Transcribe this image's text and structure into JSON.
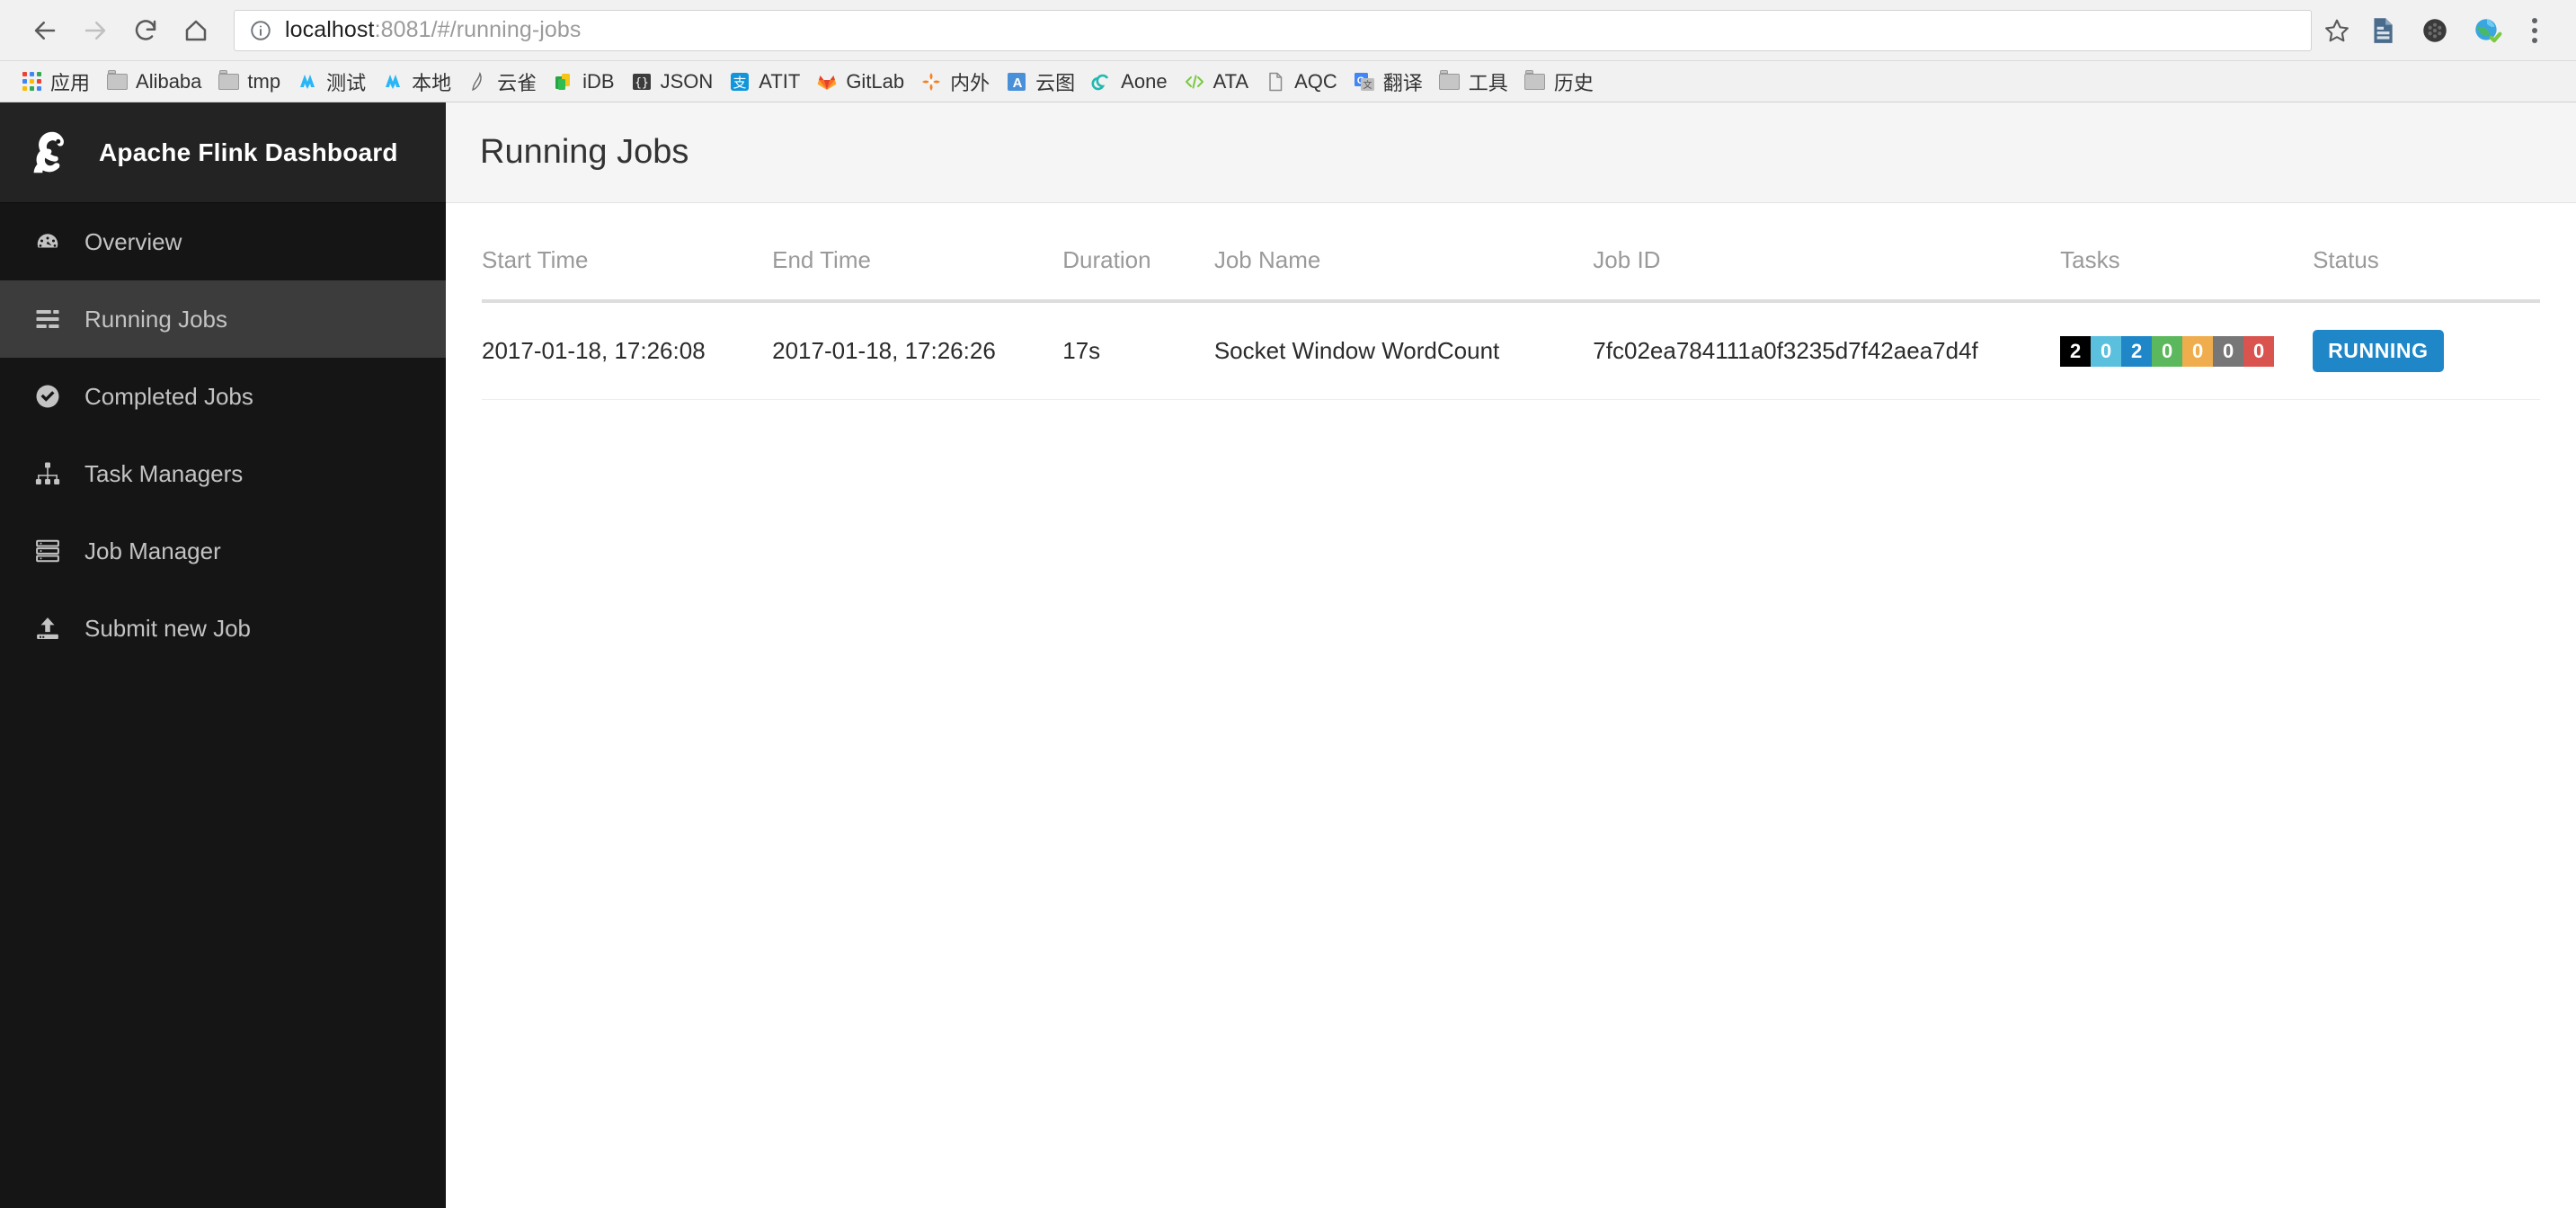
{
  "browser": {
    "back_label": "Back",
    "forward_label": "Forward",
    "reload_label": "Reload",
    "home_label": "Home",
    "url_host": "localhost",
    "url_rest": ":8081/#/running-jobs",
    "url_full": "localhost:8081/#/running-jobs",
    "star_label": "Bookmark this page",
    "menu_label": "Customize and control Google Chrome",
    "extensions": [
      {
        "name": "document-extension-icon"
      },
      {
        "name": "gear-extension-icon"
      },
      {
        "name": "globe-check-extension-icon"
      }
    ]
  },
  "bookmarks": [
    {
      "label": "应用",
      "icon": "apps-grid-icon"
    },
    {
      "label": "Alibaba",
      "icon": "folder-icon"
    },
    {
      "label": "tmp",
      "icon": "folder-icon"
    },
    {
      "label": "测试",
      "icon": "nebula-icon"
    },
    {
      "label": "本地",
      "icon": "nebula-icon"
    },
    {
      "label": "云雀",
      "icon": "lark-icon"
    },
    {
      "label": "iDB",
      "icon": "database-icon"
    },
    {
      "label": "JSON",
      "icon": "json-braces-icon"
    },
    {
      "label": "ATIT",
      "icon": "alipay-icon"
    },
    {
      "label": "GitLab",
      "icon": "gitlab-fox-icon"
    },
    {
      "label": "内外",
      "icon": "orange-star-icon"
    },
    {
      "label": "云图",
      "icon": "blue-a-icon"
    },
    {
      "label": "Aone",
      "icon": "teal-swirl-icon"
    },
    {
      "label": "ATA",
      "icon": "code-tag-icon"
    },
    {
      "label": "AQC",
      "icon": "page-icon"
    },
    {
      "label": "翻译",
      "icon": "google-translate-icon"
    },
    {
      "label": "工具",
      "icon": "folder-icon"
    },
    {
      "label": "历史",
      "icon": "folder-icon"
    }
  ],
  "sidebar": {
    "brand": "Apache Flink Dashboard",
    "logo_icon": "flink-squirrel-icon",
    "items": [
      {
        "label": "Overview",
        "icon": "dashboard-gauge-icon",
        "active": false
      },
      {
        "label": "Running Jobs",
        "icon": "running-list-icon",
        "active": true
      },
      {
        "label": "Completed Jobs",
        "icon": "check-circle-icon",
        "active": false
      },
      {
        "label": "Task Managers",
        "icon": "sitemap-icon",
        "active": false
      },
      {
        "label": "Job Manager",
        "icon": "server-stack-icon",
        "active": false
      },
      {
        "label": "Submit new Job",
        "icon": "upload-icon",
        "active": false
      }
    ]
  },
  "main": {
    "page_title": "Running Jobs",
    "table": {
      "columns": [
        "Start Time",
        "End Time",
        "Duration",
        "Job Name",
        "Job ID",
        "Tasks",
        "Status"
      ],
      "rows": [
        {
          "start_time": "2017-01-18, 17:26:08",
          "end_time": "2017-01-18, 17:26:26",
          "duration": "17s",
          "job_name": "Socket Window WordCount",
          "job_id": "7fc02ea784111a0f3235d7f42aea7d4f",
          "tasks": [
            {
              "value": "2",
              "color": "#000000",
              "state": "total"
            },
            {
              "value": "0",
              "color": "#5bc0de",
              "state": "created"
            },
            {
              "value": "2",
              "color": "#1f87c7",
              "state": "running"
            },
            {
              "value": "0",
              "color": "#5cb85c",
              "state": "finished"
            },
            {
              "value": "0",
              "color": "#f0ad4e",
              "state": "canceling"
            },
            {
              "value": "0",
              "color": "#777777",
              "state": "canceled"
            },
            {
              "value": "0",
              "color": "#d9534f",
              "state": "failed"
            }
          ],
          "status": "RUNNING",
          "status_color": "#1f87c7"
        }
      ]
    }
  }
}
